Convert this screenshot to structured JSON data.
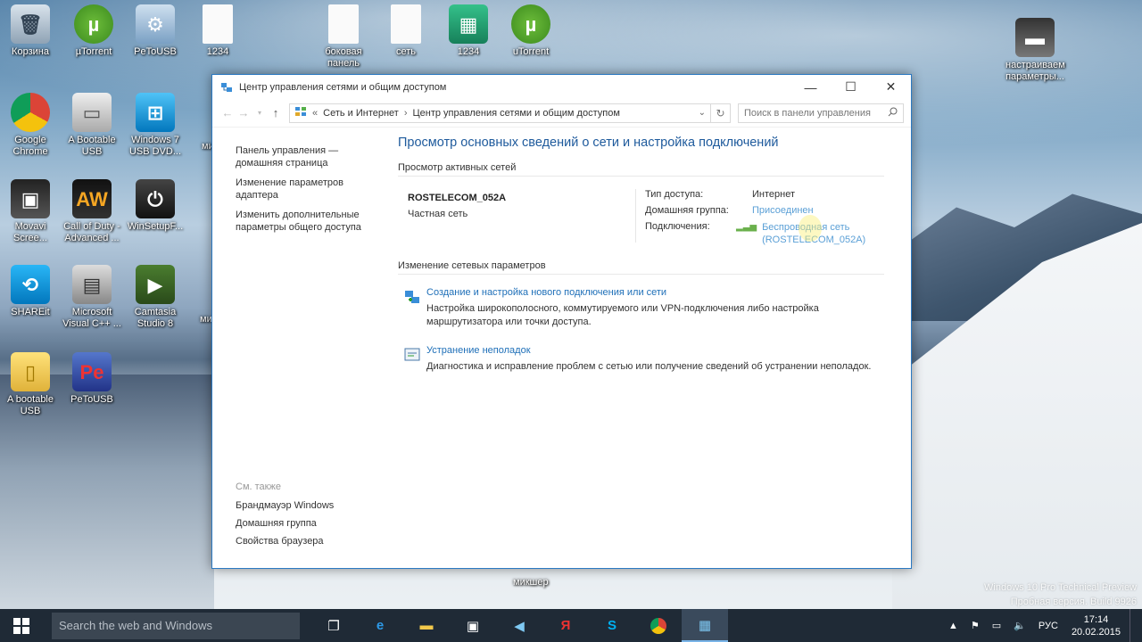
{
  "desktop": {
    "icons": [
      {
        "label": "Корзина",
        "icon": "recycle-bin-icon",
        "glyph": "🗑"
      },
      {
        "label": "µTorrent",
        "icon": "utorrent-icon",
        "glyph": "µ"
      },
      {
        "label": "PeToUSB",
        "icon": "petousb-gear-icon",
        "glyph": "⚙"
      },
      {
        "label": "1234",
        "icon": "file-icon",
        "glyph": ""
      },
      {
        "label": "боковая панель",
        "icon": "file-icon",
        "glyph": ""
      },
      {
        "label": "сеть",
        "icon": "file-icon",
        "glyph": ""
      },
      {
        "label": "1234",
        "icon": "registry-file-icon",
        "glyph": "▦"
      },
      {
        "label": "uTorrent",
        "icon": "utorrent-icon",
        "glyph": "µ"
      },
      {
        "label": "Google Chrome",
        "icon": "chrome-icon",
        "glyph": ""
      },
      {
        "label": "A Bootable USB",
        "icon": "usb-drive-icon",
        "glyph": "▭"
      },
      {
        "label": "Windows 7 USB DVD...",
        "icon": "windows7-usb-icon",
        "glyph": "⊞"
      },
      {
        "label": "Movavi Scree...",
        "icon": "movavi-icon",
        "glyph": "▣"
      },
      {
        "label": "Call of Duty - Advanced ...",
        "icon": "aw-icon",
        "glyph": "AW"
      },
      {
        "label": "WinSetupF...",
        "icon": "winsetup-usb-icon",
        "glyph": "⏻"
      },
      {
        "label": "SHAREit",
        "icon": "shareit-icon",
        "glyph": "⟲"
      },
      {
        "label": "Microsoft Visual C++ ...",
        "icon": "visual-cpp-icon",
        "glyph": "▤"
      },
      {
        "label": "Camtasia Studio 8",
        "icon": "camtasia-icon",
        "glyph": "▶"
      },
      {
        "label": "A bootable USB",
        "icon": "folder-icon",
        "glyph": "▯"
      },
      {
        "label": "PeToUSB",
        "icon": "petousb-icon",
        "glyph": "Pe"
      },
      {
        "label": "настраиваем параметры...",
        "icon": "video-file-icon",
        "glyph": "▬"
      }
    ],
    "partial_labels": {
      "mik1": "мик",
      "mik2": "ми",
      "mikser": "микшер"
    },
    "watermark_line1": "Windows 10 Pro Technical Preview",
    "watermark_line2": "Пробная версия. Build 9926"
  },
  "window": {
    "title": "Центр управления сетями и общим доступом",
    "address": {
      "root_glyph": "«",
      "crumb1": "Сеть и Интернет",
      "crumb2": "Центр управления сетями и общим доступом"
    },
    "search_placeholder": "Поиск в панели управления",
    "sidebar": {
      "home": "Панель управления — домашняя страница",
      "adapter": "Изменение параметров адаптера",
      "sharing": "Изменить дополнительные параметры общего доступа"
    },
    "see_also": {
      "header": "См. также",
      "items": [
        "Брандмауэр Windows",
        "Домашняя группа",
        "Свойства браузера"
      ]
    },
    "main": {
      "heading": "Просмотр основных сведений о сети и настройка подключений",
      "active_networks_header": "Просмотр активных сетей",
      "network_name": "ROSTELECOM_052A",
      "network_type": "Частная сеть",
      "access_type_label": "Тип доступа:",
      "access_type_value": "Интернет",
      "homegroup_label": "Домашняя группа:",
      "homegroup_value": "Присоединен",
      "connections_label": "Подключения:",
      "connection_value_line1": "Беспроводная сеть",
      "connection_value_line2": "(ROSTELECOM_052A)",
      "change_settings_header": "Изменение сетевых параметров",
      "task1_link": "Создание и настройка нового подключения или сети",
      "task1_desc": "Настройка широкополосного, коммутируемого или VPN-подключения либо настройка маршрутизатора или точки доступа.",
      "task2_link": "Устранение неполадок",
      "task2_desc": "Диагностика и исправление проблем с сетью или получение сведений об устранении неполадок."
    }
  },
  "taskbar": {
    "search_placeholder": "Search the web and Windows",
    "language": "РУС",
    "time": "17:14",
    "date": "20.02.2015"
  }
}
